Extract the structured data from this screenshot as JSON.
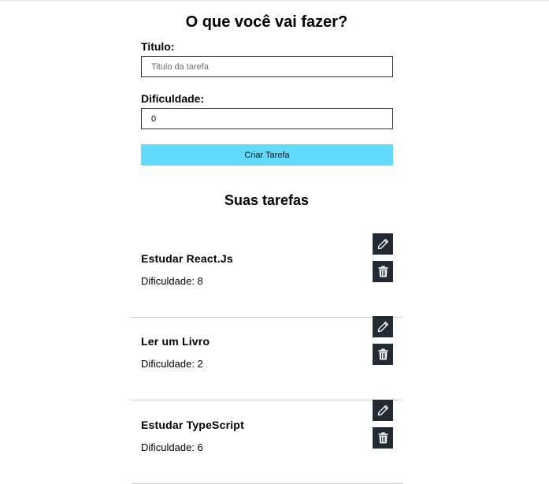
{
  "form": {
    "title": "O que você vai fazer?",
    "title_label": "Titulo:",
    "title_placeholder": "Titulo da tarefa",
    "title_value": "",
    "difficulty_label": "Dificuldade:",
    "difficulty_value": "0",
    "submit_label": "Criar Tarefa"
  },
  "list": {
    "title": "Suas tarefas",
    "tasks": [
      {
        "name": "Estudar React.Js",
        "difficulty_text": "Dificuldade: 8",
        "edit_icon": "pencil-icon",
        "delete_icon": "trash-icon"
      },
      {
        "name": "Ler um Livro",
        "difficulty_text": "Dificuldade: 2",
        "edit_icon": "pencil-icon",
        "delete_icon": "trash-icon"
      },
      {
        "name": "Estudar TypeScript",
        "difficulty_text": "Dificuldade: 6",
        "edit_icon": "pencil-icon",
        "delete_icon": "trash-icon"
      }
    ]
  },
  "colors": {
    "accent": "#61dafb",
    "icon_button_bg": "#242a33",
    "divider": "#cfcfcf"
  }
}
